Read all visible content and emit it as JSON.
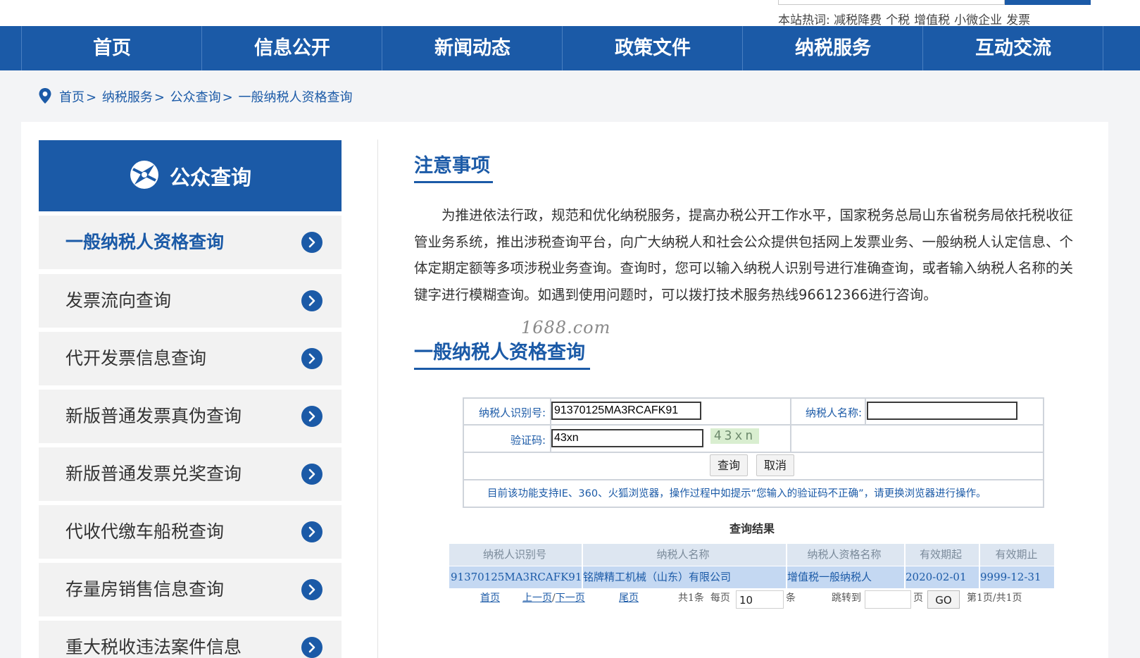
{
  "header": {
    "hotwords_label": "本站热词:",
    "hotwords": [
      "减税降费",
      "个税",
      "增值税",
      "小微企业",
      "发票"
    ]
  },
  "nav": [
    "首页",
    "信息公开",
    "新闻动态",
    "政策文件",
    "纳税服务",
    "互动交流"
  ],
  "breadcrumb": [
    "首页",
    "纳税服务",
    "公众查询",
    "一般纳税人资格查询"
  ],
  "sidebar": {
    "title": "公众查询",
    "items": [
      {
        "label": "一般纳税人资格查询",
        "active": true
      },
      {
        "label": "发票流向查询"
      },
      {
        "label": "代开发票信息查询"
      },
      {
        "label": "新版普通发票真伪查询"
      },
      {
        "label": "新版普通发票兑奖查询"
      },
      {
        "label": "代收代缴车船税查询"
      },
      {
        "label": "存量房销售信息查询"
      },
      {
        "label": "重大税收违法案件信息"
      }
    ]
  },
  "main": {
    "notice_title": "注意事项",
    "notice_text": "为推进依法行政，规范和优化纳税服务，提高办税公开工作水平，国家税务总局山东省税务局依托税收征管业务系统，推出涉税查询平台，向广大纳税人和社会公众提供包括网上发票业务、一般纳税人认定信息、个体定期定额等多项涉税业务查询。查询时，您可以输入纳税人识别号进行准确查询，或者输入纳税人名称的关键字进行模糊查询。如遇到使用问题时，可以拨打技术服务热线96612366进行咨询。",
    "watermark": "1688.com",
    "query_title": "一般纳税人资格查询"
  },
  "form": {
    "taxpayer_id_label": "纳税人识别号:",
    "taxpayer_id_value": "91370125MA3RCAFK91",
    "taxpayer_name_label": "纳税人名称:",
    "taxpayer_name_value": "",
    "captcha_label": "验证码:",
    "captcha_value": "43xn",
    "captcha_image_text": "43xn",
    "query_button": "查询",
    "cancel_button": "取消",
    "tip": "目前该功能支持IE、360、火狐浏览器，操作过程中如提示“您输入的验证码不正确”，请更换浏览器进行操作。"
  },
  "results": {
    "title": "查询结果",
    "columns": [
      "纳税人识别号",
      "纳税人名称",
      "纳税人资格名称",
      "有效期起",
      "有效期止"
    ],
    "rows": [
      [
        "91370125MA3RCAFK91",
        "铭牌精工机械（山东）有限公司",
        "增值税一般纳税人",
        "2020-02-01",
        "9999-12-31"
      ]
    ]
  },
  "pager": {
    "first": "首页",
    "prev": "上一页",
    "slash": "/",
    "next": "下一页",
    "last": "尾页",
    "total": "共1条",
    "per_page_label": "每页",
    "per_page_value": "10",
    "per_page_unit": "条",
    "jump_label": "跳转到",
    "jump_value": "",
    "page_unit": "页",
    "go": "GO",
    "status": "第1页/共1页"
  },
  "colors": {
    "primary": "#1b5aa7",
    "result_row": "#c4d8f2",
    "captcha_bg": "#d9eed0"
  }
}
